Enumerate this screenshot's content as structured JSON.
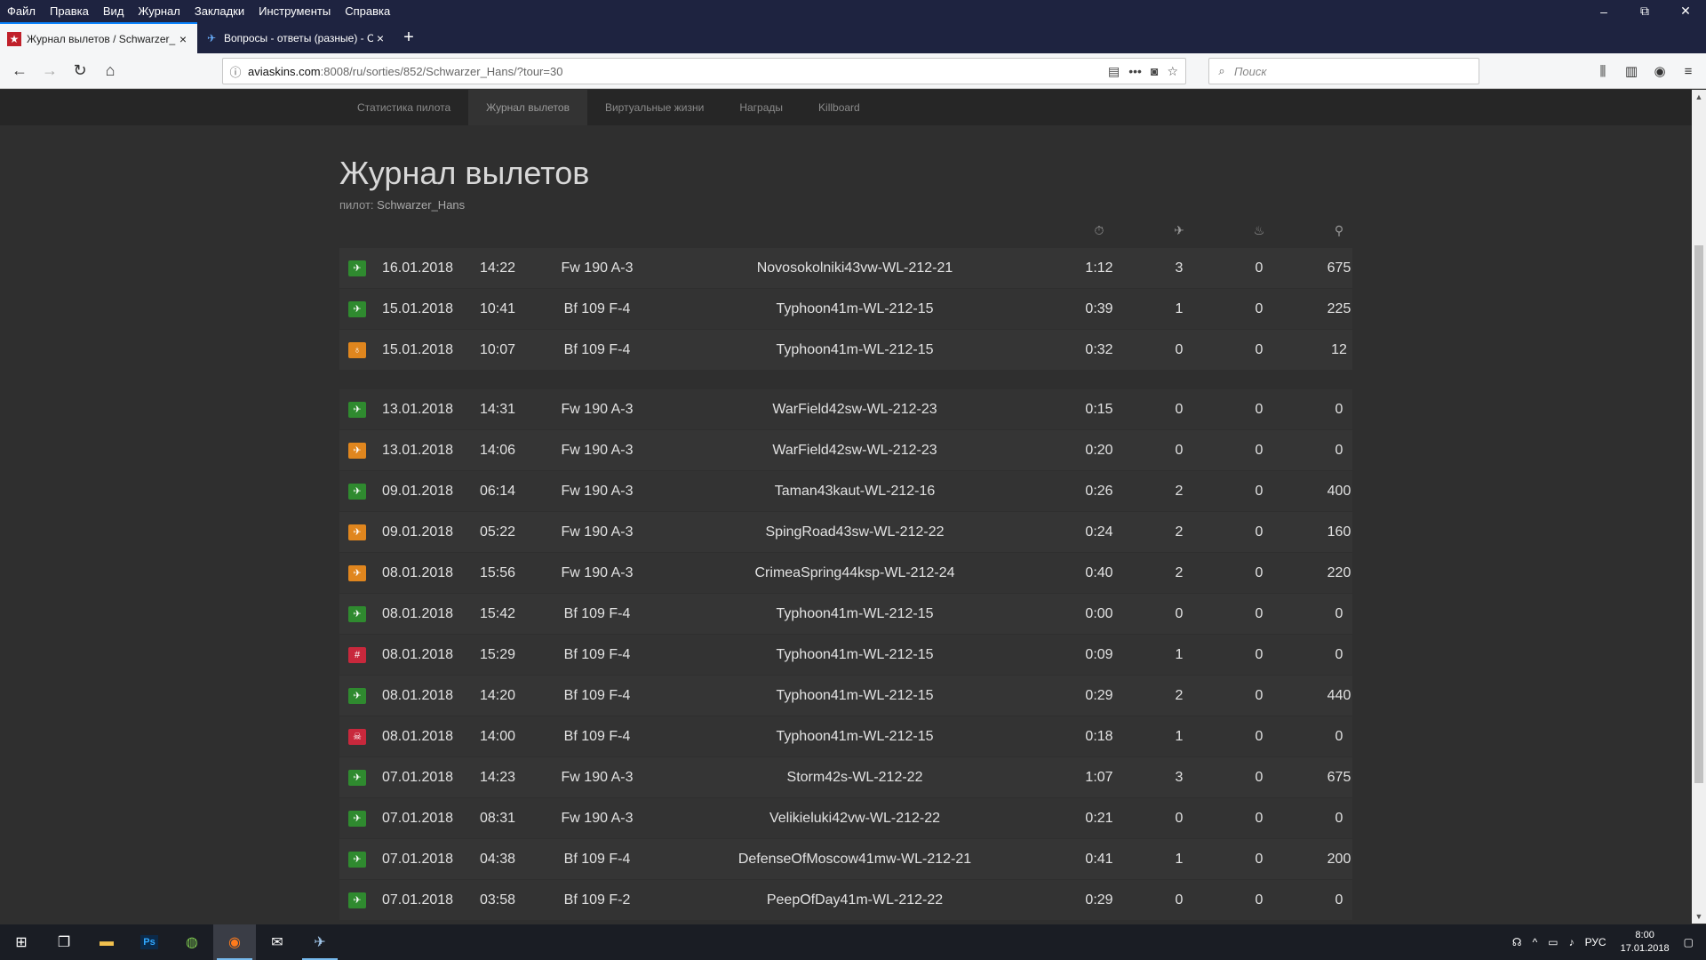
{
  "browser": {
    "menu": [
      "Файл",
      "Правка",
      "Вид",
      "Журнал",
      "Закладки",
      "Инструменты",
      "Справка"
    ],
    "tabs": [
      {
        "label": "Журнал вылетов / Schwarzer_H",
        "close": "×",
        "active": true
      },
      {
        "label": "Вопросы - ответы (разные) - C",
        "close": "×",
        "active": false
      }
    ],
    "new_tab": "+",
    "url_host": "aviaskins.com",
    "url_path": ":8008/ru/sorties/852/Schwarzer_Hans/?tour=30",
    "search_placeholder": "Поиск"
  },
  "site": {
    "subnav": [
      "Статистика пилота",
      "Журнал вылетов",
      "Виртуальные жизни",
      "Награды",
      "Killboard"
    ],
    "active_subnav": 1,
    "title": "Журнал вылетов",
    "pilot_label": "пилот:",
    "pilot_name": "Schwarzer_Hans",
    "columns": {
      "duration_icon": "stopwatch-icon",
      "kills_icon": "plane-icon",
      "ground_icon": "fire-icon",
      "score_icon": "medal-icon"
    },
    "sorties": [
      {
        "status": "landed",
        "color": "green",
        "date": "16.01.2018",
        "time": "14:22",
        "aircraft": "Fw 190 A-3",
        "mission": "Novosokolniki43vw-WL-212-21",
        "duration": "1:12",
        "air_kills": "3",
        "ground_kills": "0",
        "score": "675"
      },
      {
        "status": "landed",
        "color": "green",
        "date": "15.01.2018",
        "time": "10:41",
        "aircraft": "Bf 109 F-4",
        "mission": "Typhoon41m-WL-212-15",
        "duration": "0:39",
        "air_kills": "1",
        "ground_kills": "0",
        "score": "225"
      },
      {
        "status": "bailed",
        "color": "orange",
        "date": "15.01.2018",
        "time": "10:07",
        "aircraft": "Bf 109 F-4",
        "mission": "Typhoon41m-WL-212-15",
        "duration": "0:32",
        "air_kills": "0",
        "ground_kills": "0",
        "score": "12"
      },
      {
        "status": "in-flight",
        "color": "green",
        "date": "13.01.2018",
        "time": "14:31",
        "aircraft": "Fw 190 A-3",
        "mission": "WarField42sw-WL-212-23",
        "duration": "0:15",
        "air_kills": "0",
        "ground_kills": "0",
        "score": "0"
      },
      {
        "status": "crashed",
        "color": "orange",
        "date": "13.01.2018",
        "time": "14:06",
        "aircraft": "Fw 190 A-3",
        "mission": "WarField42sw-WL-212-23",
        "duration": "0:20",
        "air_kills": "0",
        "ground_kills": "0",
        "score": "0"
      },
      {
        "status": "landed",
        "color": "green",
        "date": "09.01.2018",
        "time": "06:14",
        "aircraft": "Fw 190 A-3",
        "mission": "Taman43kaut-WL-212-16",
        "duration": "0:26",
        "air_kills": "2",
        "ground_kills": "0",
        "score": "400"
      },
      {
        "status": "crashed",
        "color": "orange",
        "date": "09.01.2018",
        "time": "05:22",
        "aircraft": "Fw 190 A-3",
        "mission": "SpingRoad43sw-WL-212-22",
        "duration": "0:24",
        "air_kills": "2",
        "ground_kills": "0",
        "score": "160"
      },
      {
        "status": "crashed",
        "color": "orange",
        "date": "08.01.2018",
        "time": "15:56",
        "aircraft": "Fw 190 A-3",
        "mission": "CrimeaSpring44ksp-WL-212-24",
        "duration": "0:40",
        "air_kills": "2",
        "ground_kills": "0",
        "score": "220"
      },
      {
        "status": "in-flight",
        "color": "green",
        "date": "08.01.2018",
        "time": "15:42",
        "aircraft": "Bf 109 F-4",
        "mission": "Typhoon41m-WL-212-15",
        "duration": "0:00",
        "air_kills": "0",
        "ground_kills": "0",
        "score": "0"
      },
      {
        "status": "captured",
        "color": "red",
        "date": "08.01.2018",
        "time": "15:29",
        "aircraft": "Bf 109 F-4",
        "mission": "Typhoon41m-WL-212-15",
        "duration": "0:09",
        "air_kills": "1",
        "ground_kills": "0",
        "score": "0"
      },
      {
        "status": "landed",
        "color": "green",
        "date": "08.01.2018",
        "time": "14:20",
        "aircraft": "Bf 109 F-4",
        "mission": "Typhoon41m-WL-212-15",
        "duration": "0:29",
        "air_kills": "2",
        "ground_kills": "0",
        "score": "440"
      },
      {
        "status": "killed",
        "color": "red",
        "date": "08.01.2018",
        "time": "14:00",
        "aircraft": "Bf 109 F-4",
        "mission": "Typhoon41m-WL-212-15",
        "duration": "0:18",
        "air_kills": "1",
        "ground_kills": "0",
        "score": "0"
      },
      {
        "status": "landed",
        "color": "green",
        "date": "07.01.2018",
        "time": "14:23",
        "aircraft": "Fw 190 A-3",
        "mission": "Storm42s-WL-212-22",
        "duration": "1:07",
        "air_kills": "3",
        "ground_kills": "0",
        "score": "675"
      },
      {
        "status": "landed",
        "color": "green",
        "date": "07.01.2018",
        "time": "08:31",
        "aircraft": "Fw 190 A-3",
        "mission": "Velikieluki42vw-WL-212-22",
        "duration": "0:21",
        "air_kills": "0",
        "ground_kills": "0",
        "score": "0"
      },
      {
        "status": "landed",
        "color": "green",
        "date": "07.01.2018",
        "time": "04:38",
        "aircraft": "Bf 109 F-4",
        "mission": "DefenseOfMoscow41mw-WL-212-21",
        "duration": "0:41",
        "air_kills": "1",
        "ground_kills": "0",
        "score": "200"
      },
      {
        "status": "in-flight",
        "color": "green",
        "date": "07.01.2018",
        "time": "03:58",
        "aircraft": "Bf 109 F-2",
        "mission": "PeepOfDay41m-WL-212-22",
        "duration": "0:29",
        "air_kills": "0",
        "ground_kills": "0",
        "score": "0"
      }
    ]
  },
  "taskbar": {
    "lang": "РУС",
    "time": "8:00",
    "date": "17.01.2018"
  }
}
